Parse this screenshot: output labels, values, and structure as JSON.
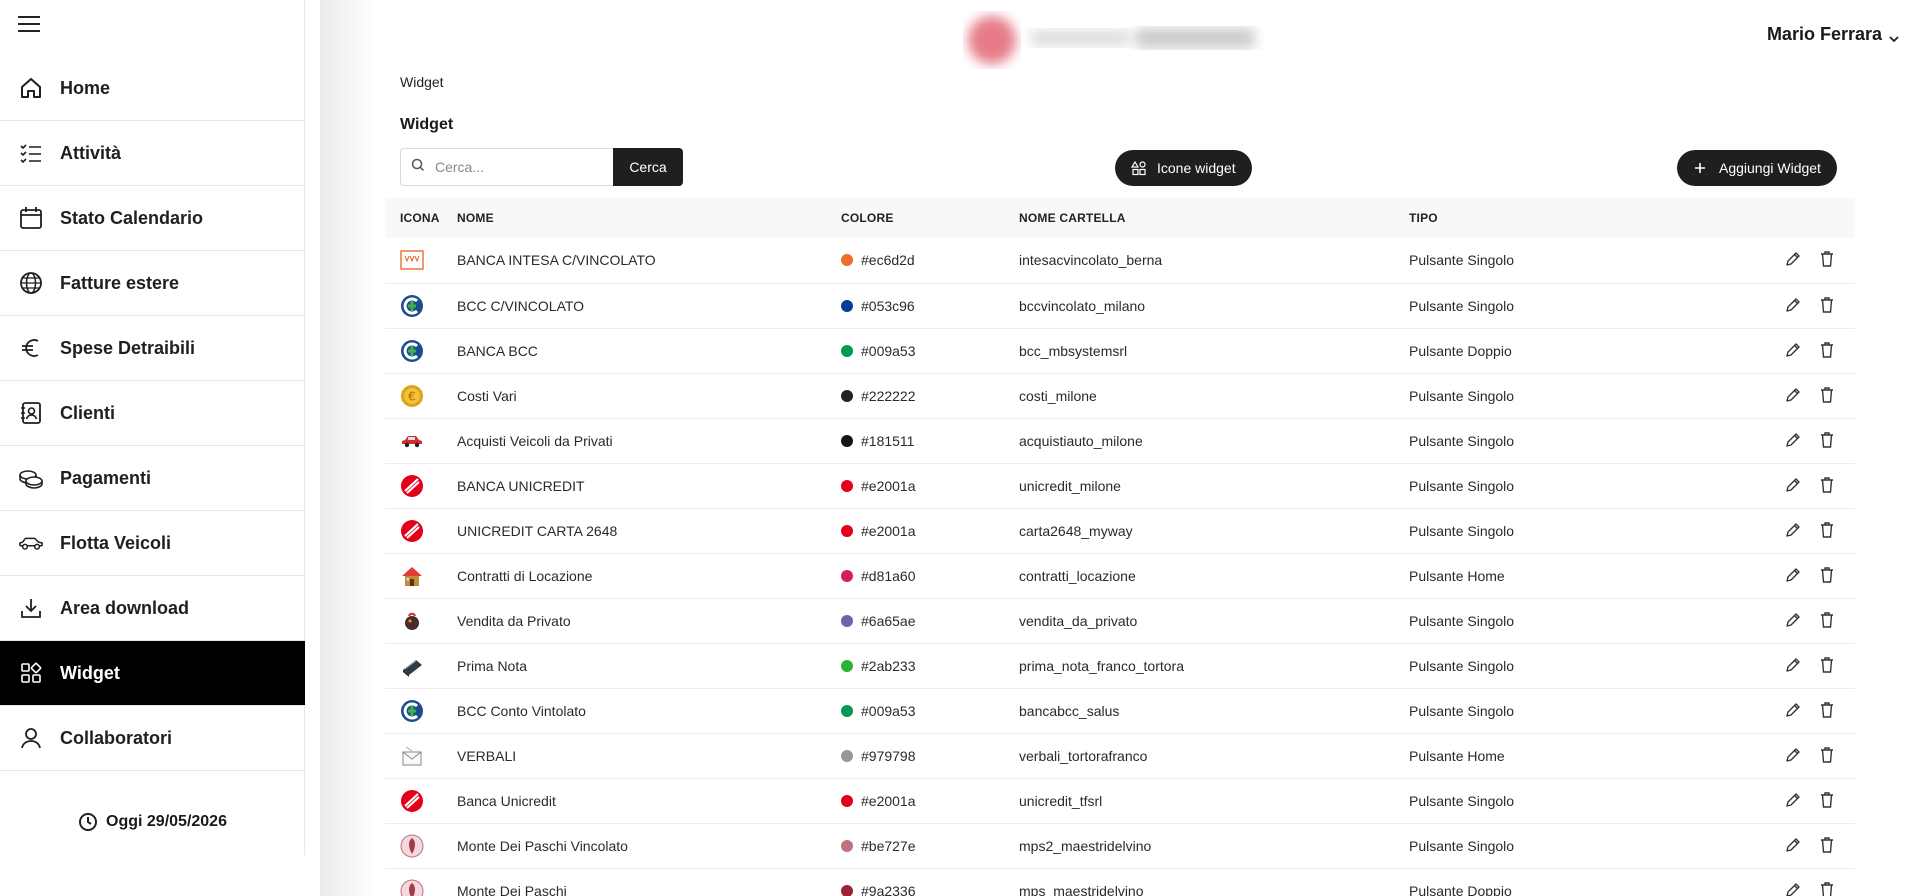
{
  "header": {
    "user_name": "Mario Ferrara"
  },
  "sidebar": {
    "items": [
      {
        "label": "Home",
        "icon": "home-icon",
        "active": false
      },
      {
        "label": "Attività",
        "icon": "checklist-icon",
        "active": false
      },
      {
        "label": "Stato Calendario",
        "icon": "calendar-icon",
        "active": false
      },
      {
        "label": "Fatture estere",
        "icon": "globe-icon",
        "active": false
      },
      {
        "label": "Spese Detraibili",
        "icon": "euro-icon",
        "active": false
      },
      {
        "label": "Clienti",
        "icon": "contacts-icon",
        "active": false
      },
      {
        "label": "Pagamenti",
        "icon": "coins-icon",
        "active": false
      },
      {
        "label": "Flotta Veicoli",
        "icon": "car-icon",
        "active": false
      },
      {
        "label": "Area download",
        "icon": "download-icon",
        "active": false
      },
      {
        "label": "Widget",
        "icon": "widgets-icon",
        "active": true
      },
      {
        "label": "Collaboratori",
        "icon": "user-icon",
        "active": false
      }
    ],
    "today": "Oggi 29/05/2026"
  },
  "breadcrumb": "Widget",
  "page": {
    "title": "Widget",
    "search_placeholder": "Cerca...",
    "search_button": "Cerca",
    "icons_button": "Icone widget",
    "add_button": "Aggiungi Widget"
  },
  "table": {
    "headers": {
      "icon": "ICONA",
      "name": "NOME",
      "color": "COLORE",
      "folder": "NOME CARTELLA",
      "type": "TIPO"
    },
    "rows": [
      {
        "icon": "intesa-logo-icon",
        "name": "BANCA INTESA C/VINCOLATO",
        "color": "#ec6d2d",
        "folder": "intesacvincolato_berna",
        "type": "Pulsante Singolo"
      },
      {
        "icon": "bcc-logo-icon",
        "name": "BCC C/VINCOLATO",
        "color": "#053c96",
        "folder": "bccvincolato_milano",
        "type": "Pulsante Singolo"
      },
      {
        "icon": "bcc-logo-icon",
        "name": "BANCA BCC",
        "color": "#009a53",
        "folder": "bcc_mbsystemsrl",
        "type": "Pulsante Doppio"
      },
      {
        "icon": "euro-coin-icon",
        "name": "Costi Vari",
        "color": "#222222",
        "folder": "costi_milone",
        "type": "Pulsante Singolo"
      },
      {
        "icon": "red-car-icon",
        "name": "Acquisti Veicoli da Privati",
        "color": "#181511",
        "folder": "acquistiauto_milone",
        "type": "Pulsante Singolo"
      },
      {
        "icon": "unicredit-logo-icon",
        "name": "BANCA UNICREDIT",
        "color": "#e2001a",
        "folder": "unicredit_milone",
        "type": "Pulsante Singolo"
      },
      {
        "icon": "unicredit-logo-icon",
        "name": "UNICREDIT CARTA 2648",
        "color": "#e2001a",
        "folder": "carta2648_myway",
        "type": "Pulsante Singolo"
      },
      {
        "icon": "house-icon",
        "name": "Contratti di Locazione",
        "color": "#d81a60",
        "folder": "contratti_locazione",
        "type": "Pulsante Home"
      },
      {
        "icon": "bag-icon",
        "name": "Vendita da Privato",
        "color": "#6a65ae",
        "folder": "vendita_da_privato",
        "type": "Pulsante Singolo"
      },
      {
        "icon": "notebook-icon",
        "name": "Prima Nota",
        "color": "#2ab233",
        "folder": "prima_nota_franco_tortora",
        "type": "Pulsante Singolo"
      },
      {
        "icon": "bcc-logo-icon",
        "name": "BCC Conto Vintolato",
        "color": "#009a53",
        "folder": "bancabcc_salus",
        "type": "Pulsante Singolo"
      },
      {
        "icon": "envelope-icon",
        "name": "VERBALI",
        "color": "#979798",
        "folder": "verbali_tortorafranco",
        "type": "Pulsante Home"
      },
      {
        "icon": "unicredit-logo-icon",
        "name": "Banca Unicredit",
        "color": "#e2001a",
        "folder": "unicredit_tfsrl",
        "type": "Pulsante Singolo"
      },
      {
        "icon": "mps-logo-icon",
        "name": "Monte Dei Paschi Vincolato",
        "color": "#be727e",
        "folder": "mps2_maestridelvino",
        "type": "Pulsante Singolo"
      },
      {
        "icon": "mps-logo-icon",
        "name": "Monte Dei Paschi",
        "color": "#9a2336",
        "folder": "mps_maestridelvino",
        "type": "Pulsante Doppio"
      }
    ]
  }
}
